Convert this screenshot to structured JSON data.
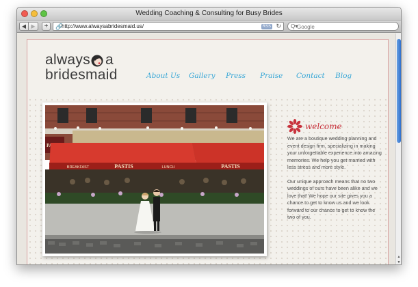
{
  "window": {
    "title": "Wedding Coaching & Consulting for Busy Brides"
  },
  "toolbar": {
    "back_icon": "◀",
    "forward_icon": "▶",
    "add_icon": "+",
    "url": "http://www.alwaysabridesmaid.us/",
    "rss_label": "RSS",
    "reload_icon": "↻",
    "search_placeholder": "Google",
    "search_icon": "Q▾"
  },
  "site": {
    "logo_line1": "always",
    "logo_a": "a",
    "logo_line2": "bridesmaid",
    "nav": [
      {
        "label": "About Us"
      },
      {
        "label": "Gallery"
      },
      {
        "label": "Press"
      },
      {
        "label": "Praise"
      },
      {
        "label": "Contact"
      },
      {
        "label": "Blog"
      }
    ],
    "welcome": {
      "title": "welcome",
      "para1": "We are a boutique wedding planning and event design firm, specializing in making your unforgettable experience into amazing memories. We help you get married with less stress and more style.",
      "para2": "Our unique approach means that no two weddings of ours have been alike and we love that! We hope our site gives you a chance to get to know us and we look forward to our chance to get to know the two of you."
    },
    "photo_signs": {
      "awning_left": "BREAKFAST",
      "awning_name": "PASTIS",
      "awning_lunch": "LUNCH",
      "awning_right": "PASTIS",
      "side_sign": "PASTIS"
    }
  },
  "colors": {
    "nav_link": "#36a6d6",
    "welcome_accent": "#c8323c",
    "page_border": "#d8a0a0"
  }
}
